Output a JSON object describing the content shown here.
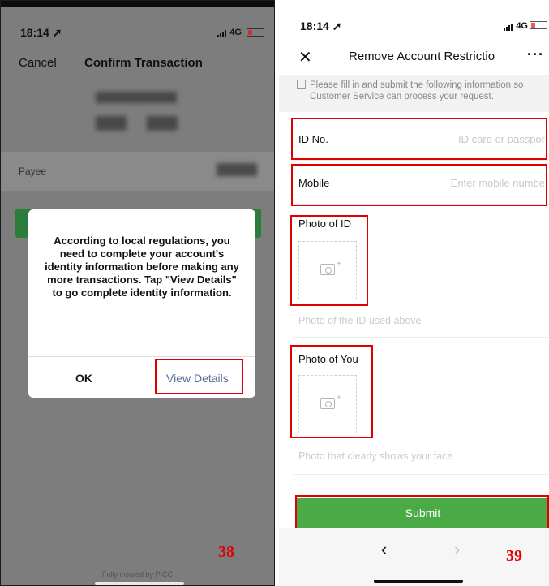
{
  "left_screen": {
    "status_bar": {
      "time": "18:14 ➚",
      "network": "4G"
    },
    "nav": {
      "cancel_label": "Cancel",
      "title": "Confirm Transaction"
    },
    "payee_label": "Payee",
    "dialog": {
      "message": "According to local regulations, you need to complete your account's identity information before making any more transactions. Tap \"View Details\" to go complete identity information.",
      "ok_label": "OK",
      "view_details_label": "View Details"
    },
    "footer_text": "Fully insured by PICC",
    "figure_number": "38"
  },
  "right_screen": {
    "status_bar": {
      "time": "18:14 ➚",
      "network": "4G"
    },
    "nav": {
      "close_glyph": "✕",
      "title": "Remove Account Restrictio",
      "more_glyph": "···"
    },
    "notice": "Please fill in and submit the following information so Customer Service can process your request.",
    "id_field": {
      "label": "ID No.",
      "placeholder": "ID card or passpor"
    },
    "mobile_field": {
      "label": "Mobile",
      "placeholder": "Enter mobile numbe"
    },
    "photo_id": {
      "label": "Photo of ID",
      "hint": "Photo of the ID used above"
    },
    "photo_you": {
      "label": "Photo of You",
      "hint": "Photo that clearly shows your face"
    },
    "submit_label": "Submit",
    "back_glyph": "‹",
    "forward_glyph": "›",
    "figure_number": "39"
  },
  "colors": {
    "highlight_red": "#e00000",
    "submit_green": "#4aaa46",
    "link_blue": "#576b95"
  }
}
